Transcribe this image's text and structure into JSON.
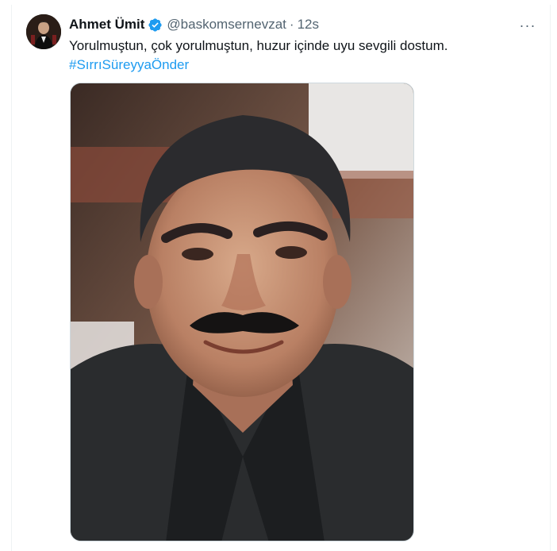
{
  "tweet": {
    "display_name": "Ahmet Ümit",
    "handle": "@baskomsernevzat",
    "separator": "·",
    "time": "12s",
    "text": "Yorulmuştun, çok yorulmuştun, huzur içinde uyu sevgili dostum.",
    "hashtag": "#SırrıSüreyyaÖnder",
    "more_label": "···"
  },
  "colors": {
    "link": "#1d9bf0",
    "secondary_text": "#536471",
    "verified_badge": "#1d9bf0"
  },
  "icons": {
    "verified": "verified-badge-icon",
    "more": "more-options-icon"
  }
}
